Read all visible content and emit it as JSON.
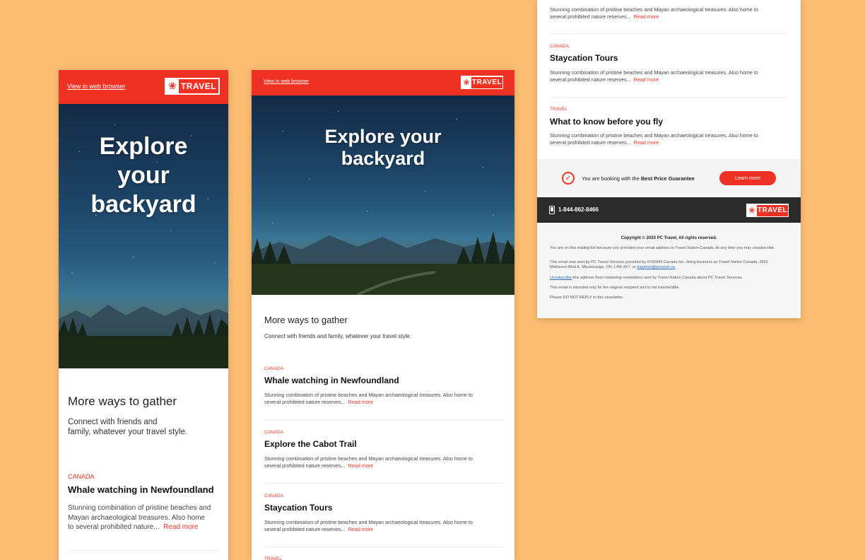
{
  "brand": {
    "red": "#EF3124",
    "background": "#FBBD73",
    "logo_mark": "❀",
    "logo_text": "TRAVEL"
  },
  "header": {
    "view_link": "View in web browser"
  },
  "hero": {
    "line1": "Explore",
    "line2": "your",
    "line3": "backyard",
    "wide_line1": "Explore your",
    "wide_line2": "backyard"
  },
  "intro": {
    "title": "More ways to gather",
    "subtitle": "Connect with friends and family, whatever your travel style.",
    "subtitle_line1": "Connect with friends and",
    "subtitle_line2": "family, whatever your travel style."
  },
  "read_more": "Read more",
  "articles": [
    {
      "tag": "CANADA",
      "title": "Whale watching in Newfoundland",
      "desc": "Stunning combination of pristine beaches and Mayan archaeological treasures. Also home to several prohibited nature reserves...",
      "desc_line1": "Stunning combination of pristine beaches and Mayan archaeological treasures. Also home to",
      "desc_line2": "several prohibited nature reserves...",
      "mobile_l1": "Stunning combination of pristine beaches and",
      "mobile_l2": "Mayan archaeological treasures. Also home",
      "mobile_l3": "to several prohibited nature..."
    },
    {
      "tag": "CANADA",
      "title": "Explore the Cabot Trail",
      "desc_line1": "Stunning combination of pristine beaches and Mayan archaeological treasures. Also home to",
      "desc_line2": "several prohibited nature reserves..."
    },
    {
      "tag": "CANADA",
      "title": "Staycation Tours",
      "desc_line1": "Stunning combination of pristine beaches and Mayan archaeological treasures. Also home to",
      "desc_line2": "several prohibited nature reserves..."
    },
    {
      "tag": "TRAVEL",
      "title": "What to know before you fly",
      "desc_line1": "Stunning combination of pristine beaches and Mayan archaeological treasures. Also home to",
      "desc_line2": "several prohibited nature reserves..."
    }
  ],
  "top_article": {
    "desc_line1": "Stunning combination of pristine beaches and Mayan archaeological treasures. Also home to",
    "desc_line2": "several prohibited nature reserves..."
  },
  "guarantee": {
    "prefix": "You are booking with the ",
    "strong": "Best Price Guarantee",
    "button": "Learn more"
  },
  "footer": {
    "phone": "1-844-862-8466",
    "copyright": "Copyright © 2020 PC Travel, All rights reserved.",
    "p1": "You are on this mailing list because you provided your email address to Travel Nation Canada. At any time you may unsubscribe.",
    "p2": "This email was sent by PC Travel Services provided by 6742995 Canada Inc. doing business as Travel Nation Canada, 2810 Matheson Blvd E, Mississauga, ON, L4W 4X7, or ",
    "p2_link": "inquiries@pctravel.ca",
    "p3_link": "Unsubscribe",
    "p3": " this address from marketing newsletters sent by Travel Nation Canada about PC Travel Services.",
    "p4": "This email is intended only for the original recipient and is not transferable.",
    "p5": "Please DO NOT REPLY to this newsletter."
  }
}
